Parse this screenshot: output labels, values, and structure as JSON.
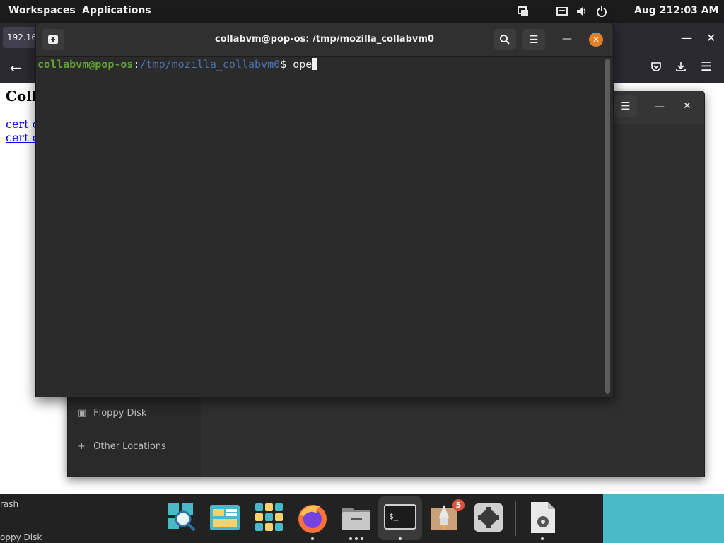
{
  "topbar": {
    "workspaces": "Workspaces",
    "applications": "Applications",
    "date": "Aug 21",
    "time": "2:03 AM",
    "icons": [
      "screen-share-icon",
      "keyboard-icon",
      "volume-icon",
      "power-icon"
    ]
  },
  "firefox": {
    "tab_label": "192.168",
    "page_heading": "Coll",
    "links": [
      "cert c",
      "cert c"
    ]
  },
  "files": {
    "sidebar": [
      {
        "label": "Floppy Disk",
        "icon": "floppy-icon"
      },
      {
        "label": "Other Locations",
        "icon": "plus-icon"
      }
    ]
  },
  "terminal": {
    "title": "collabvm@pop-os: /tmp/mozilla_collabvm0",
    "prompt_user": "collabvm@pop-os",
    "prompt_sep": ":",
    "prompt_path": "/tmp/mozilla_collabvm0",
    "prompt_symbol": "$ ",
    "command": "ope"
  },
  "dock": {
    "left_text_1": "rash",
    "left_text_2": "oppy Disk",
    "badge_count": "5",
    "apps": [
      "search-app-icon",
      "files-layout-app-icon",
      "app-grid-icon",
      "firefox-icon",
      "file-manager-icon",
      "terminal-icon",
      "popshop-icon",
      "settings-icon",
      "document-settings-icon"
    ]
  },
  "colors": {
    "prompt_user": "#5fa030",
    "prompt_path": "#4f73b7",
    "close_button": "#e1802c",
    "dock_teal": "#48b9c7"
  }
}
